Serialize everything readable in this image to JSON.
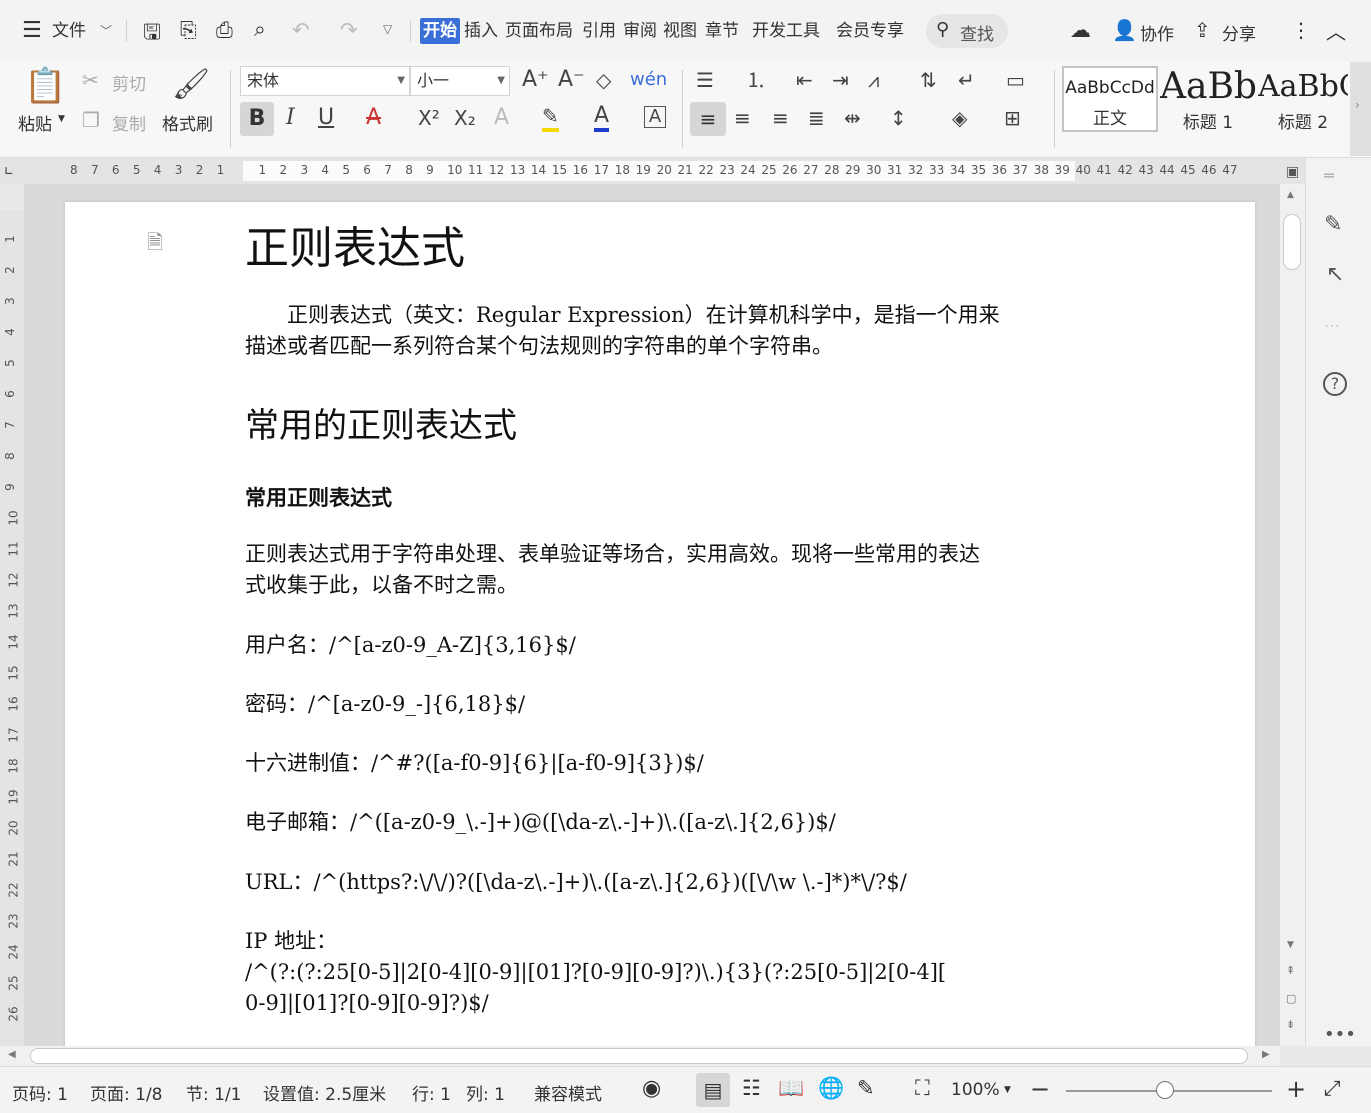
{
  "menubar": {
    "file": "文件",
    "tabs": [
      "开始",
      "插入",
      "页面布局",
      "引用",
      "审阅",
      "视图",
      "章节",
      "开发工具",
      "会员专享"
    ],
    "search": "查找",
    "collab": "协作",
    "share": "分享"
  },
  "ribbon": {
    "paste": "粘贴",
    "cut": "剪切",
    "copy": "复制",
    "format_painter": "格式刷",
    "font_name": "宋体",
    "font_size": "小一",
    "styles": [
      {
        "sample": "AaBbCcDd",
        "label": "正文"
      },
      {
        "sample": "AaBb",
        "label": "标题 1"
      },
      {
        "sample": "AaBbC",
        "label": "标题 2"
      }
    ]
  },
  "ruler": {
    "h_ticks": [
      "8",
      "7",
      "6",
      "5",
      "4",
      "3",
      "2",
      "1",
      "",
      "1",
      "2",
      "3",
      "4",
      "5",
      "6",
      "7",
      "8",
      "9",
      "10",
      "11",
      "12",
      "13",
      "14",
      "15",
      "16",
      "17",
      "18",
      "19",
      "20",
      "21",
      "22",
      "23",
      "24",
      "25",
      "26",
      "27",
      "28",
      "29",
      "30",
      "31",
      "32",
      "33",
      "34",
      "35",
      "36",
      "37",
      "38",
      "39",
      "40",
      "41",
      "42",
      "43",
      "44",
      "45",
      "46",
      "47"
    ],
    "v_ticks": [
      "1",
      "2",
      "3",
      "4",
      "5",
      "6",
      "7",
      "8",
      "9",
      "10",
      "11",
      "12",
      "13",
      "14",
      "15",
      "16",
      "17",
      "18",
      "19",
      "20",
      "21",
      "22",
      "23",
      "24",
      "25",
      "26"
    ]
  },
  "document": {
    "title": "正则表达式",
    "intro_line1": "　　正则表达式（英文：Regular Expression）在计算机科学中，是指一个用来",
    "intro_line2": "描述或者匹配一系列符合某个句法规则的字符串的单个字符串。",
    "h2": "常用的正则表达式",
    "h3": "常用正则表达式",
    "desc_line1": "正则表达式用于字符串处理、表单验证等场合，实用高效。现将一些常用的表达",
    "desc_line2": "式收集于此，以备不时之需。",
    "username": "用户名：/^[a-z0-9_A-Z]{3,16}$/",
    "password": "密码：/^[a-z0-9_-]{6,18}$/",
    "hex": "十六进制值：/^#?([a-f0-9]{6}|[a-f0-9]{3})$/",
    "email": "电子邮箱：/^([a-z0-9_\\.-]+)@([\\da-z\\.-]+)\\.([a-z\\.]{2,6})$/",
    "url": "URL：/^(https?:\\/\\/)?([\\da-z\\.-]+)\\.([a-z\\.]{2,6})([\\/\\w \\.-]*)*\\/?$/",
    "ip_label": "IP 地址：",
    "ip_line1": "/^(?:(?:25[0-5]|2[0-4][0-9]|[01]?[0-9][0-9]?)\\.){3}(?:25[0-5]|2[0-4][",
    "ip_line2": "0-9]|[01]?[0-9][0-9]?)$/"
  },
  "status": {
    "page_no": "页码: 1",
    "pages": "页面: 1/8",
    "section": "节: 1/1",
    "setting": "设置值: 2.5厘米",
    "row": "行: 1",
    "col": "列: 1",
    "compat": "兼容模式",
    "zoom": "100%"
  },
  "colors": {
    "accent": "#3b6fd8",
    "highlight": "#f5d800",
    "font_color": "#1f3ccf"
  }
}
